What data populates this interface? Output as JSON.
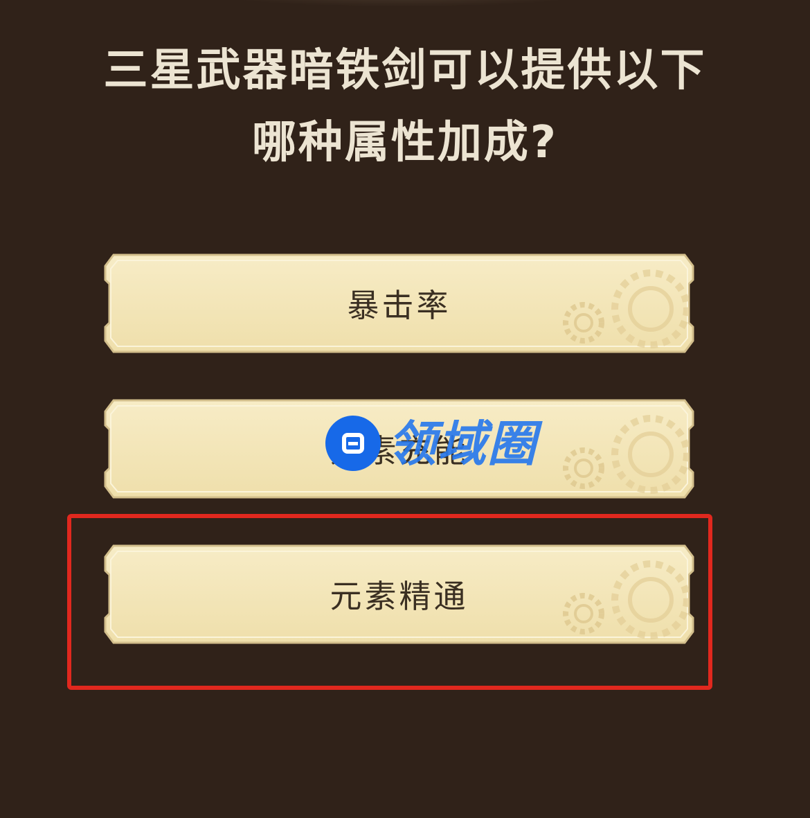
{
  "question": {
    "line1": "三星武器暗铁剑可以提供以下",
    "line2": "哪种属性加成?"
  },
  "options": [
    {
      "label": "暴击率"
    },
    {
      "label": "元素充能"
    },
    {
      "label": "元素精通"
    }
  ],
  "highlighted_option_index": 2,
  "watermark": {
    "text": "领域圈",
    "icon": "app-logo-icon"
  },
  "colors": {
    "background": "#302219",
    "question_text": "#ece4d2",
    "option_fill": "#f4e6b8",
    "option_border": "#d8c490",
    "option_text": "#3a2f22",
    "highlight_border": "#e0281e",
    "watermark_blue": "#1769e8"
  }
}
